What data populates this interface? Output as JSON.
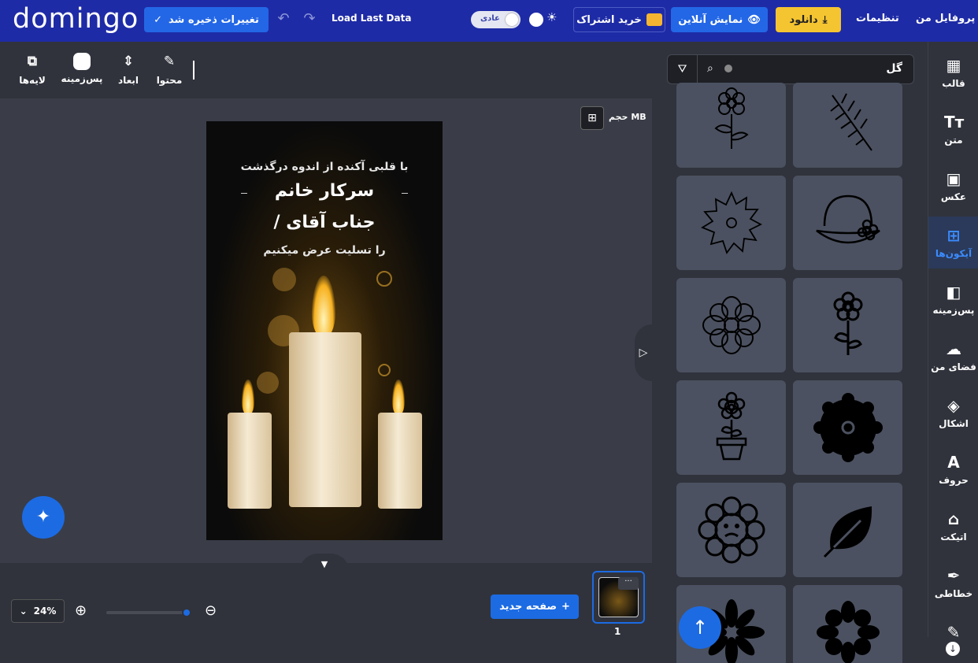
{
  "header": {
    "logo": "domingo",
    "save_label": "تغییرات ذخیره شد",
    "load_label": "Load Last Data",
    "mode_label": "عادی",
    "subscribe_label": "خرید اشتراک",
    "preview_label": "نمایش آنلاین",
    "download_label": "دانلود",
    "settings_label": "تنظیمات",
    "profile_label": "پروفایل من"
  },
  "toolbar": {
    "layers": "لایه‌ها",
    "background": "پس‌زمینه",
    "dimensions": "ابعاد",
    "content": "محتوا"
  },
  "canvas": {
    "size_label": "حجم MB",
    "poster": {
      "line1": "با قلبی آکنده از اندوه درگذشت",
      "line2": "سرکار خانم",
      "line3": "/ جناب آقای",
      "line4": "را تسلیت عرض میکنیم"
    }
  },
  "bottom": {
    "zoom": "24%",
    "zoom_level": 0.24,
    "new_page": "صفحه جدید",
    "page_number": "1"
  },
  "assets": {
    "search_value": "گل",
    "icons": [
      "flower-outline-icon",
      "fern-leaf-icon",
      "sun-flower-outline-icon",
      "hat-flower-icon",
      "daisy-outline-icon",
      "flower-stem-icon",
      "potted-flower-icon",
      "scalloped-flower-solid-icon",
      "sad-flower-icon",
      "leaf-solid-icon",
      "starburst-flower-solid-icon",
      "daisy-solid-icon"
    ]
  },
  "sidebar": {
    "items": [
      "قالب",
      "متن",
      "عکس",
      "آیکون‌ها",
      "پس‌زمینه",
      "فضای من",
      "اشکال",
      "حروف",
      "اتیکت",
      "خطاطی"
    ],
    "active": "آیکون‌ها"
  },
  "colors": {
    "header_bg": "#1e2ba6",
    "accent": "#1c6be3",
    "download": "#f5c531",
    "panel_bg": "#30333c"
  }
}
